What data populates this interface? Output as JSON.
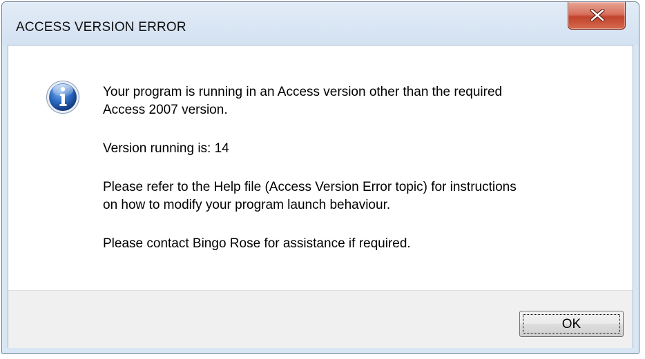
{
  "dialog": {
    "title": "ACCESS VERSION ERROR",
    "close_icon": "close-icon",
    "info_icon": "information-icon",
    "message": {
      "line1": "Your program is running in an Access version other than the required",
      "line2": "Access 2007 version.",
      "line3": "Version running is: 14",
      "line4": "Please refer to the Help file (Access Version Error topic) for instructions",
      "line5": "on how to modify your program launch behaviour.",
      "line6": "Please contact Bingo Rose for assistance if required."
    },
    "ok_label": "OK"
  },
  "colors": {
    "close_button": "#c7462f",
    "frame": "#d9e6f4",
    "info_icon": "#2a5fb0"
  }
}
